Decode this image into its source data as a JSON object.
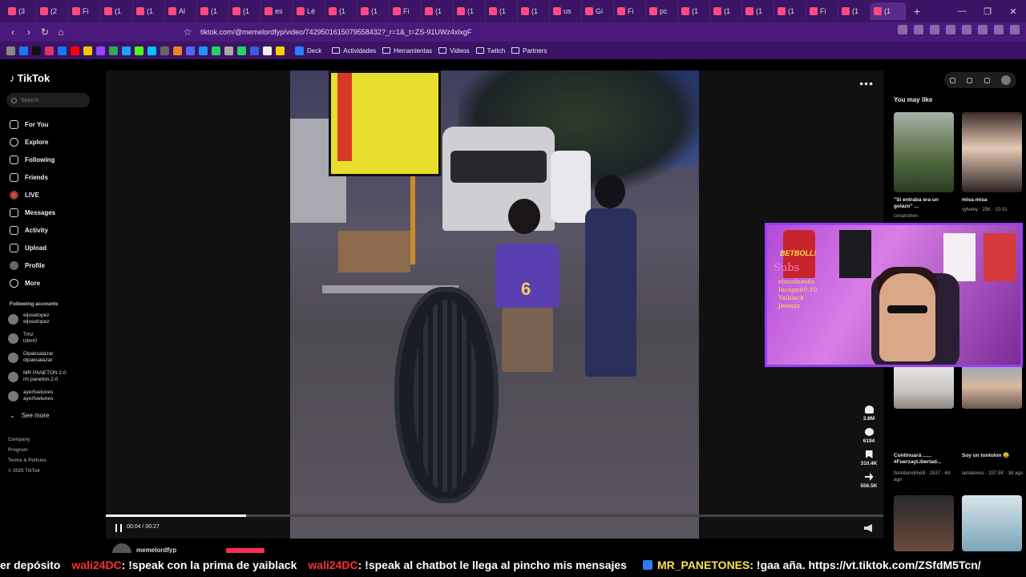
{
  "browser": {
    "url": "tiktok.com/@memelordfyp/video/7429501615079558432?_r=1&_t=ZS-91UWz4xlxgF",
    "tabs": [
      {
        "label": "(3"
      },
      {
        "label": "(2"
      },
      {
        "label": "Fi"
      },
      {
        "label": "(1"
      },
      {
        "label": "(1"
      },
      {
        "label": "Al"
      },
      {
        "label": "(1"
      },
      {
        "label": "(1"
      },
      {
        "label": "es"
      },
      {
        "label": "Lé"
      },
      {
        "label": "(1"
      },
      {
        "label": "(1"
      },
      {
        "label": "Fi"
      },
      {
        "label": "(1"
      },
      {
        "label": "(1"
      },
      {
        "label": "(1"
      },
      {
        "label": "(1"
      },
      {
        "label": "us"
      },
      {
        "label": "Gi"
      },
      {
        "label": "Fi"
      },
      {
        "label": "pc"
      },
      {
        "label": "(1"
      },
      {
        "label": "(1"
      },
      {
        "label": "(1"
      },
      {
        "label": "(1"
      },
      {
        "label": "Fi"
      },
      {
        "label": "(1"
      },
      {
        "label": "(1"
      }
    ],
    "bookmarks": {
      "deck": "Deck",
      "folders": [
        "Actividades",
        "Herramientas",
        "Videos",
        "Twitch",
        "Partners"
      ]
    }
  },
  "sidebar": {
    "logo": "TikTok",
    "search_placeholder": "Search",
    "nav": [
      {
        "label": "For You"
      },
      {
        "label": "Explore"
      },
      {
        "label": "Following"
      },
      {
        "label": "Friends"
      },
      {
        "label": "LIVE"
      },
      {
        "label": "Messages"
      },
      {
        "label": "Activity"
      },
      {
        "label": "Upload"
      },
      {
        "label": "Profile"
      },
      {
        "label": "More"
      }
    ],
    "following_heading": "Following accounts",
    "following": [
      {
        "name": "eljoselopez",
        "handle": "eljoselopez"
      },
      {
        "name": "Tmz",
        "handle": "lzkm0"
      },
      {
        "name": "Dipaksalazar",
        "handle": "dipaksalazar"
      },
      {
        "name": "MR PANETON 2.0",
        "handle": "mr.paneton.2.0"
      },
      {
        "name": "ayerfuelunes",
        "handle": "ayerfuelunes"
      }
    ],
    "see_more": "See more",
    "footer": [
      "Company",
      "Program",
      "Terms & Policies",
      "© 2025 TikTok"
    ]
  },
  "player": {
    "jersey_number": "6",
    "time": "00:04 / 00:27",
    "progress_fraction": 0.18,
    "actions": [
      {
        "icon": "heart-icon",
        "count": "3.8M"
      },
      {
        "icon": "comment-icon",
        "count": "6194"
      },
      {
        "icon": "bookmark-icon",
        "count": "310.4K"
      },
      {
        "icon": "share-icon",
        "count": "556.5K"
      }
    ],
    "author": "memelordfyp"
  },
  "recommended": {
    "heading": "You may like",
    "items": [
      {
        "caption": "\"Si entraba era un golazo\" ...",
        "meta": "conanotren"
      },
      {
        "caption": "misa misa",
        "meta": "sylveey · 25K · 10-31"
      },
      {
        "caption": "Continuará ...... #FuerzayLibertad...",
        "meta": "fiorellamolinelli · 2537 · 4d ago"
      },
      {
        "caption": "Soy un tontolon 😩",
        "meta": "iamalexiss · 337.5K · 3d ago"
      }
    ]
  },
  "webcam": {
    "brand": "BETBOLL!",
    "subs_title": "Subs",
    "subs": [
      "elmodnes6s",
      "Incognit0.10",
      "Yaiblack",
      "Jemazz"
    ]
  },
  "chat_ticker": {
    "messages": [
      {
        "user": "",
        "text": "er depósito"
      },
      {
        "user": "wali24DC",
        "text": ": !speak con la prima de yaiblack"
      },
      {
        "user": "wali24DC",
        "text": ": !speak al chatbot le llega al pincho mis mensajes"
      },
      {
        "user": "MR_PANETONES",
        "text": ": !gaa aña. https://vt.tiktok.com/ZSfdM5Tcn/"
      }
    ]
  },
  "colors": {
    "browser_purple": "#3b1466",
    "tiktok_red": "#fe2c55",
    "webcam_border": "#9a3cff",
    "chat_user_red": "#ff3030",
    "chat_user_yellow": "#ffe14d"
  }
}
